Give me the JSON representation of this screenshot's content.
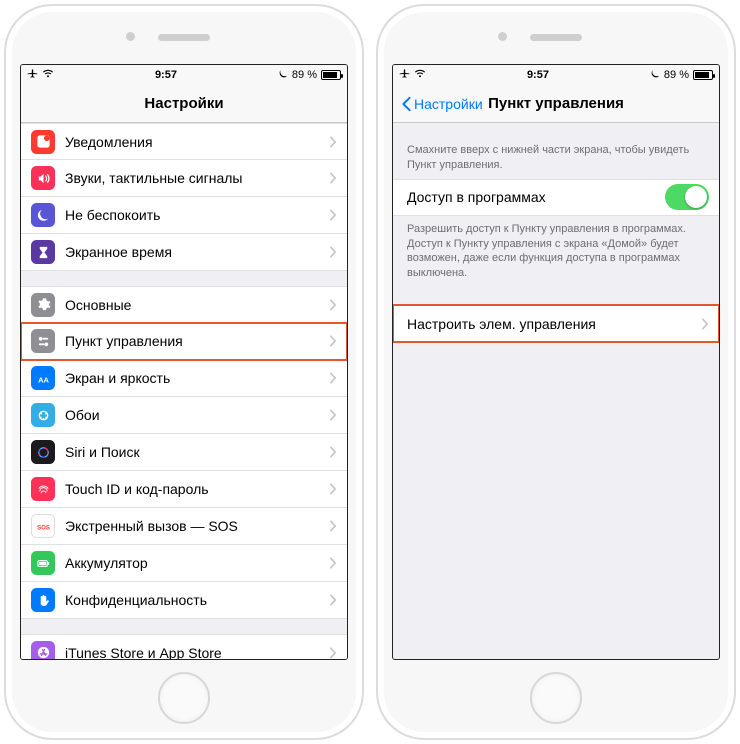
{
  "status": {
    "time": "9:57",
    "battery_pct": "89 %"
  },
  "left": {
    "title": "Настройки",
    "groups": [
      {
        "rows": [
          {
            "name": "notifications",
            "label": "Уведомления",
            "icon": "notifications-icon",
            "bg": "bg-red"
          },
          {
            "name": "sounds",
            "label": "Звуки, тактильные сигналы",
            "icon": "sounds-icon",
            "bg": "bg-pink"
          },
          {
            "name": "dnd",
            "label": "Не беспокоить",
            "icon": "moon-icon",
            "bg": "bg-purple"
          },
          {
            "name": "screen-time",
            "label": "Экранное время",
            "icon": "hourglass-icon",
            "bg": "bg-deep-purple"
          }
        ]
      },
      {
        "rows": [
          {
            "name": "general",
            "label": "Основные",
            "icon": "gear-icon",
            "bg": "bg-gray"
          },
          {
            "name": "control-center",
            "label": "Пункт управления",
            "icon": "switches-icon",
            "bg": "bg-gray",
            "highlight": true
          },
          {
            "name": "display",
            "label": "Экран и яркость",
            "icon": "display-icon",
            "bg": "bg-blue"
          },
          {
            "name": "wallpaper",
            "label": "Обои",
            "icon": "wallpaper-icon",
            "bg": "bg-cyan"
          },
          {
            "name": "siri",
            "label": "Siri и Поиск",
            "icon": "siri-icon",
            "bg": "bg-siri"
          },
          {
            "name": "touch-id",
            "label": "Touch ID и код-пароль",
            "icon": "fingerprint-icon",
            "bg": "bg-pink"
          },
          {
            "name": "sos",
            "label": "Экстренный вызов — SOS",
            "icon": "sos-icon",
            "bg": "bg-sos"
          },
          {
            "name": "battery",
            "label": "Аккумулятор",
            "icon": "battery-icon",
            "bg": "bg-green"
          },
          {
            "name": "privacy",
            "label": "Конфиденциальность",
            "icon": "hand-icon",
            "bg": "bg-blue"
          }
        ]
      },
      {
        "rows": [
          {
            "name": "itunes",
            "label": "iTunes Store и App Store",
            "icon": "appstore-icon",
            "bg": "bg-itunes"
          }
        ]
      }
    ]
  },
  "right": {
    "back_label": "Настройки",
    "title": "Пункт управления",
    "intro": "Смахните вверх с нижней части экрана, чтобы увидеть Пункт управления.",
    "access_row_label": "Доступ в программах",
    "access_footer": "Разрешить доступ к Пункту управления в программах. Доступ к Пункту управления с экрана «Домой» будет возможен, даже если функция доступа в программах выключена.",
    "customize_label": "Настроить элем. управления"
  }
}
